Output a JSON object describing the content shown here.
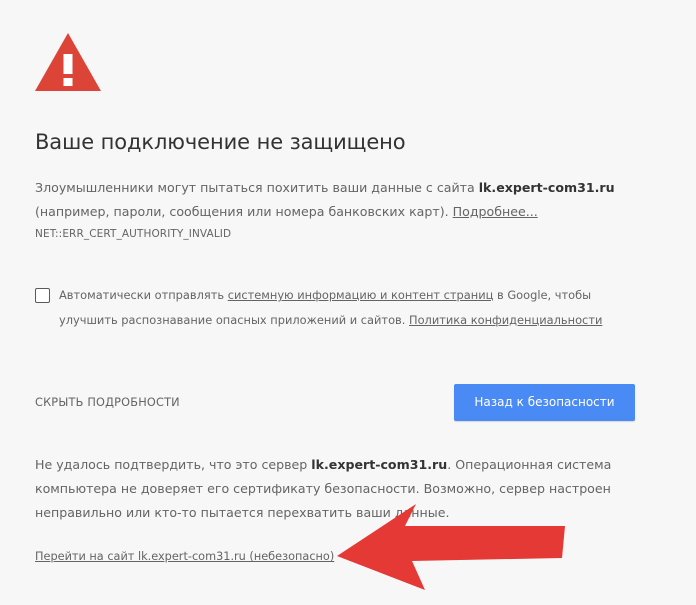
{
  "page": {
    "title": "Ваше подключение не защищено",
    "description": {
      "prefix": "Злоумышленники могут пытаться похитить ваши данные с сайта ",
      "domain": "lk.expert-com31.ru",
      "suffix": " (например, пароли, сообщения или номера банковских карт). ",
      "more_link": "Подробнее..."
    },
    "error_code": "NET::ERR_CERT_AUTHORITY_INVALID",
    "report_checkbox": {
      "checked": false,
      "text_before": "Автоматически отправлять ",
      "link_info": "системную информацию и контент страниц",
      "text_middle": " в Google, чтобы улучшить распознавание опасных приложений и сайтов. ",
      "link_privacy": "Политика конфиденциальности"
    },
    "details_button": "СКРЫТЬ ПОДРОБНОСТИ",
    "primary_button": "Назад к безопасности",
    "details_text": {
      "prefix": "Не удалось подтвердить, что это сервер ",
      "domain": "lk.expert-com31.ru",
      "suffix": ". Операционная система компьютера не доверяет его сертификату безопасности. Возможно, сервер настроен неправильно или кто-то пытается перехватить ваши данные."
    },
    "proceed_link": "Перейти на сайт lk.expert-com31.ru (небезопасно)"
  },
  "colors": {
    "background": "#f7f7f7",
    "warning_red": "#db4437",
    "primary_blue": "#4a8af4",
    "arrow_red": "#e53935",
    "text": "#646464",
    "title_text": "#333333"
  },
  "icons": {
    "warning": "warning-triangle-icon",
    "annotation_arrow": "red-arrow-icon"
  }
}
